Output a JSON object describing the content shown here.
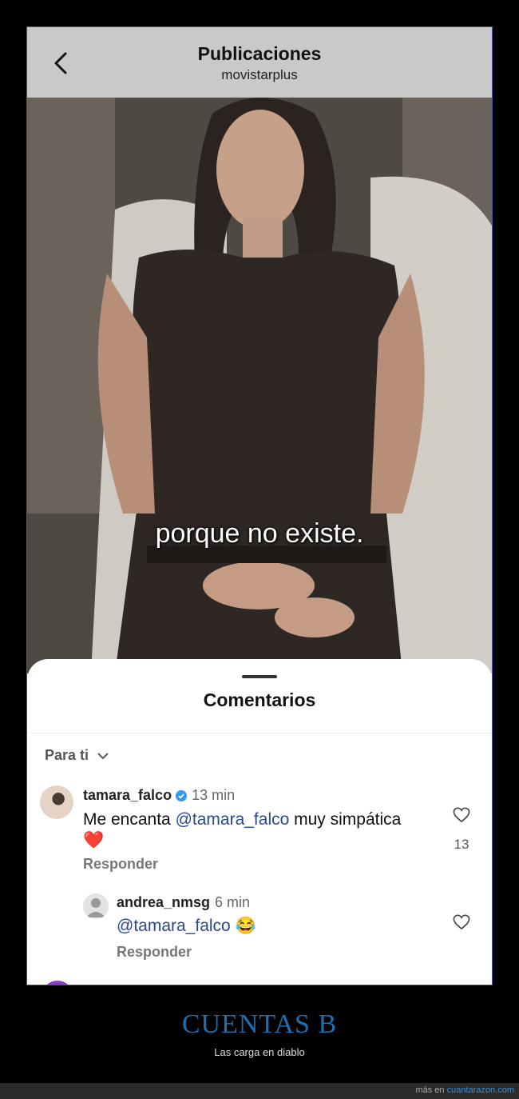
{
  "header": {
    "title": "Publicaciones",
    "subtitle": "movistarplus"
  },
  "video": {
    "caption": "porque no existe."
  },
  "comments_sheet": {
    "title": "Comentarios",
    "filter_label": "Para ti",
    "comments": [
      {
        "username": "tamara_falco",
        "verified": true,
        "time": "13 min",
        "text_before": "Me encanta ",
        "mention": "@tamara_falco",
        "text_after": " muy simpática",
        "emoji": "❤️",
        "likes": "13",
        "reply_label": "Responder"
      },
      {
        "username": "andrea_nmsg",
        "time": "6 min",
        "mention": "@tamara_falco",
        "emoji": "😂",
        "reply_label": "Responder"
      }
    ]
  },
  "footer": {
    "title": "CUENTAS B",
    "subtitle": "Las carga en diablo",
    "credit_prefix": "más en ",
    "credit_link": "cuantarazon.com"
  },
  "colors": {
    "accent_blue": "#1c6fb0",
    "mention": "#2a4a8c",
    "verified": "#3897f0"
  }
}
